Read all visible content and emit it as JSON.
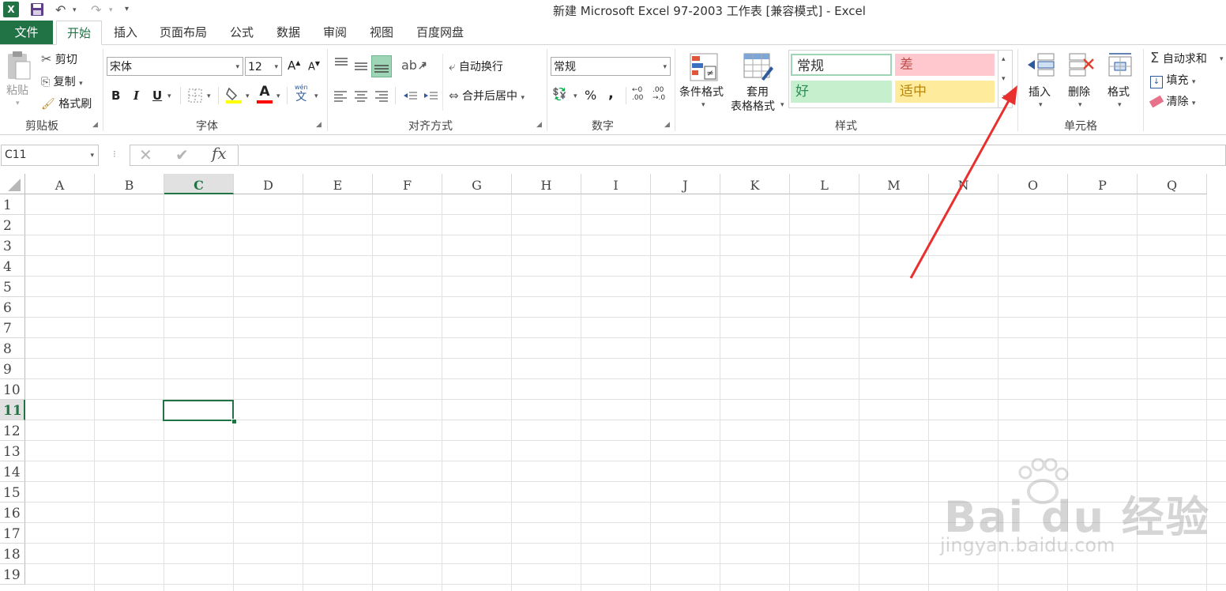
{
  "window": {
    "title": "新建 Microsoft Excel 97-2003 工作表  [兼容模式] - Excel"
  },
  "tabs": [
    "文件",
    "开始",
    "插入",
    "页面布局",
    "公式",
    "数据",
    "审阅",
    "视图",
    "百度网盘"
  ],
  "clipboard": {
    "paste": "粘贴",
    "cut": "剪切",
    "copy": "复制",
    "format_painter": "格式刷",
    "group": "剪贴板"
  },
  "font": {
    "name": "宋体",
    "size": "12",
    "bold": "B",
    "italic": "I",
    "underline": "U",
    "font_color": "A",
    "grow": "A",
    "shrink": "A",
    "phonetic": "wén",
    "group": "字体"
  },
  "alignment": {
    "wrap": "自动换行",
    "merge": "合并后居中",
    "group": "对齐方式"
  },
  "number": {
    "format": "常规",
    "percent": "%",
    "comma": ",",
    "group": "数字"
  },
  "styles": {
    "conditional": "条件格式",
    "table_line1": "套用",
    "table_line2": "表格格式",
    "normal": "常规",
    "bad": "差",
    "good": "好",
    "neutral": "适中",
    "group": "样式"
  },
  "cells": {
    "insert": "插入",
    "delete": "删除",
    "format": "格式",
    "group": "单元格"
  },
  "editing": {
    "autosum": "自动求和",
    "fill": "填充",
    "clear": "清除",
    "sigma": "Σ"
  },
  "formula_bar": {
    "name_box": "C11",
    "fx": "fx",
    "value": ""
  },
  "columns": [
    "A",
    "B",
    "C",
    "D",
    "E",
    "F",
    "G",
    "H",
    "I",
    "J",
    "K",
    "L",
    "M",
    "N",
    "O",
    "P",
    "Q"
  ],
  "rows": [
    "1",
    "2",
    "3",
    "4",
    "5",
    "6",
    "7",
    "8",
    "9",
    "10",
    "11",
    "12",
    "13",
    "14",
    "15",
    "16",
    "17",
    "18",
    "19"
  ],
  "selected_cell": {
    "column": "C",
    "row": "11"
  },
  "watermark": {
    "brand": "Bai du 经验",
    "url": "jingyan.baidu.com"
  },
  "colors": {
    "excel_green": "#217346",
    "annotation_arrow": "#e8302e",
    "style_bad": "#ffc7ce",
    "style_good": "#c6efce",
    "style_neutral": "#ffeb9c"
  }
}
